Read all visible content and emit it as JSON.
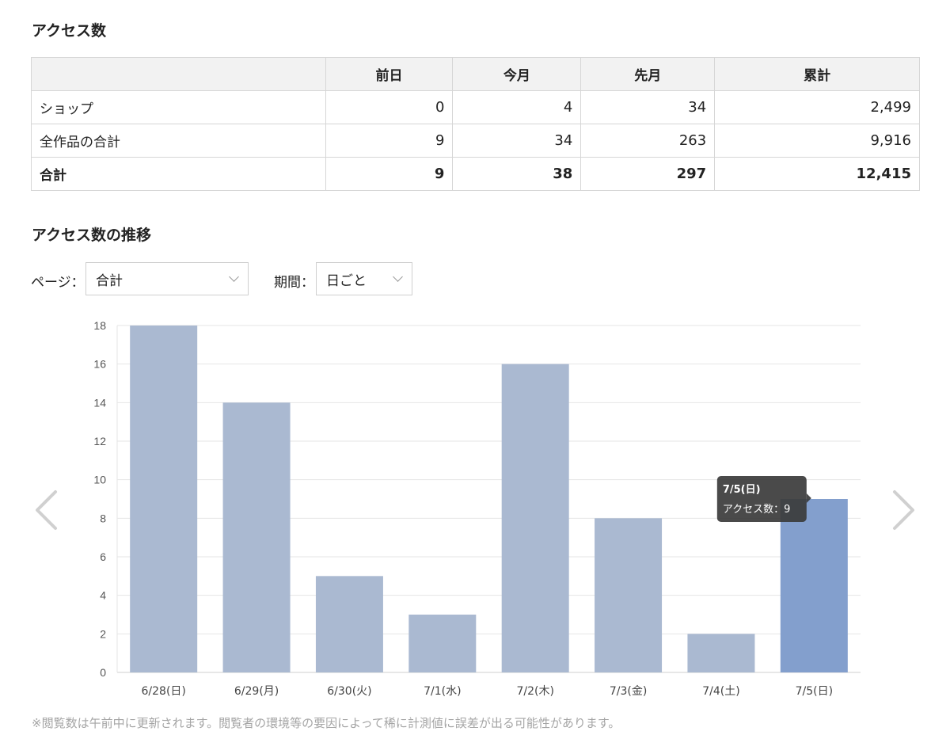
{
  "access_section": {
    "title": "アクセス数",
    "columns": [
      "",
      "前日",
      "今月",
      "先月",
      "累計"
    ],
    "rows": [
      {
        "label": "ショップ",
        "values": [
          "0",
          "4",
          "34",
          "2,499"
        ]
      },
      {
        "label": "全作品の合計",
        "values": [
          "9",
          "34",
          "263",
          "9,916"
        ]
      }
    ],
    "total": {
      "label": "合計",
      "values": [
        "9",
        "38",
        "297",
        "12,415"
      ]
    }
  },
  "trend_section": {
    "title": "アクセス数の推移",
    "page_filter": {
      "label": "ページ：",
      "value": "合計",
      "icon": "chevron-down-icon"
    },
    "period_filter": {
      "label": "期間：",
      "value": "日ごと",
      "icon": "chevron-down-icon"
    }
  },
  "chart_data": {
    "type": "bar",
    "categories": [
      "6/28(日)",
      "6/29(月)",
      "6/30(火)",
      "7/1(水)",
      "7/2(木)",
      "7/3(金)",
      "7/4(土)",
      "7/5(日)"
    ],
    "series": [
      {
        "values": [
          18,
          14,
          5,
          3,
          16,
          8,
          2,
          9
        ]
      }
    ],
    "ylim": [
      0,
      18
    ],
    "yticks": [
      0,
      2,
      4,
      6,
      8,
      10,
      12,
      14,
      16,
      18
    ],
    "grid": true,
    "bar_color": "#aab9d1",
    "highlight_color": "#839fcd",
    "highlight_index": 7,
    "tooltip": {
      "title": "7/5(日)",
      "label": "アクセス数：9"
    }
  },
  "nav": {
    "prev_icon": "chevron-left-icon",
    "next_icon": "chevron-right-icon"
  },
  "note": "※閲覧数は午前中に更新されます。閲覧者の環境等の要因によって稀に計測値に誤差が出る可能性があります。"
}
